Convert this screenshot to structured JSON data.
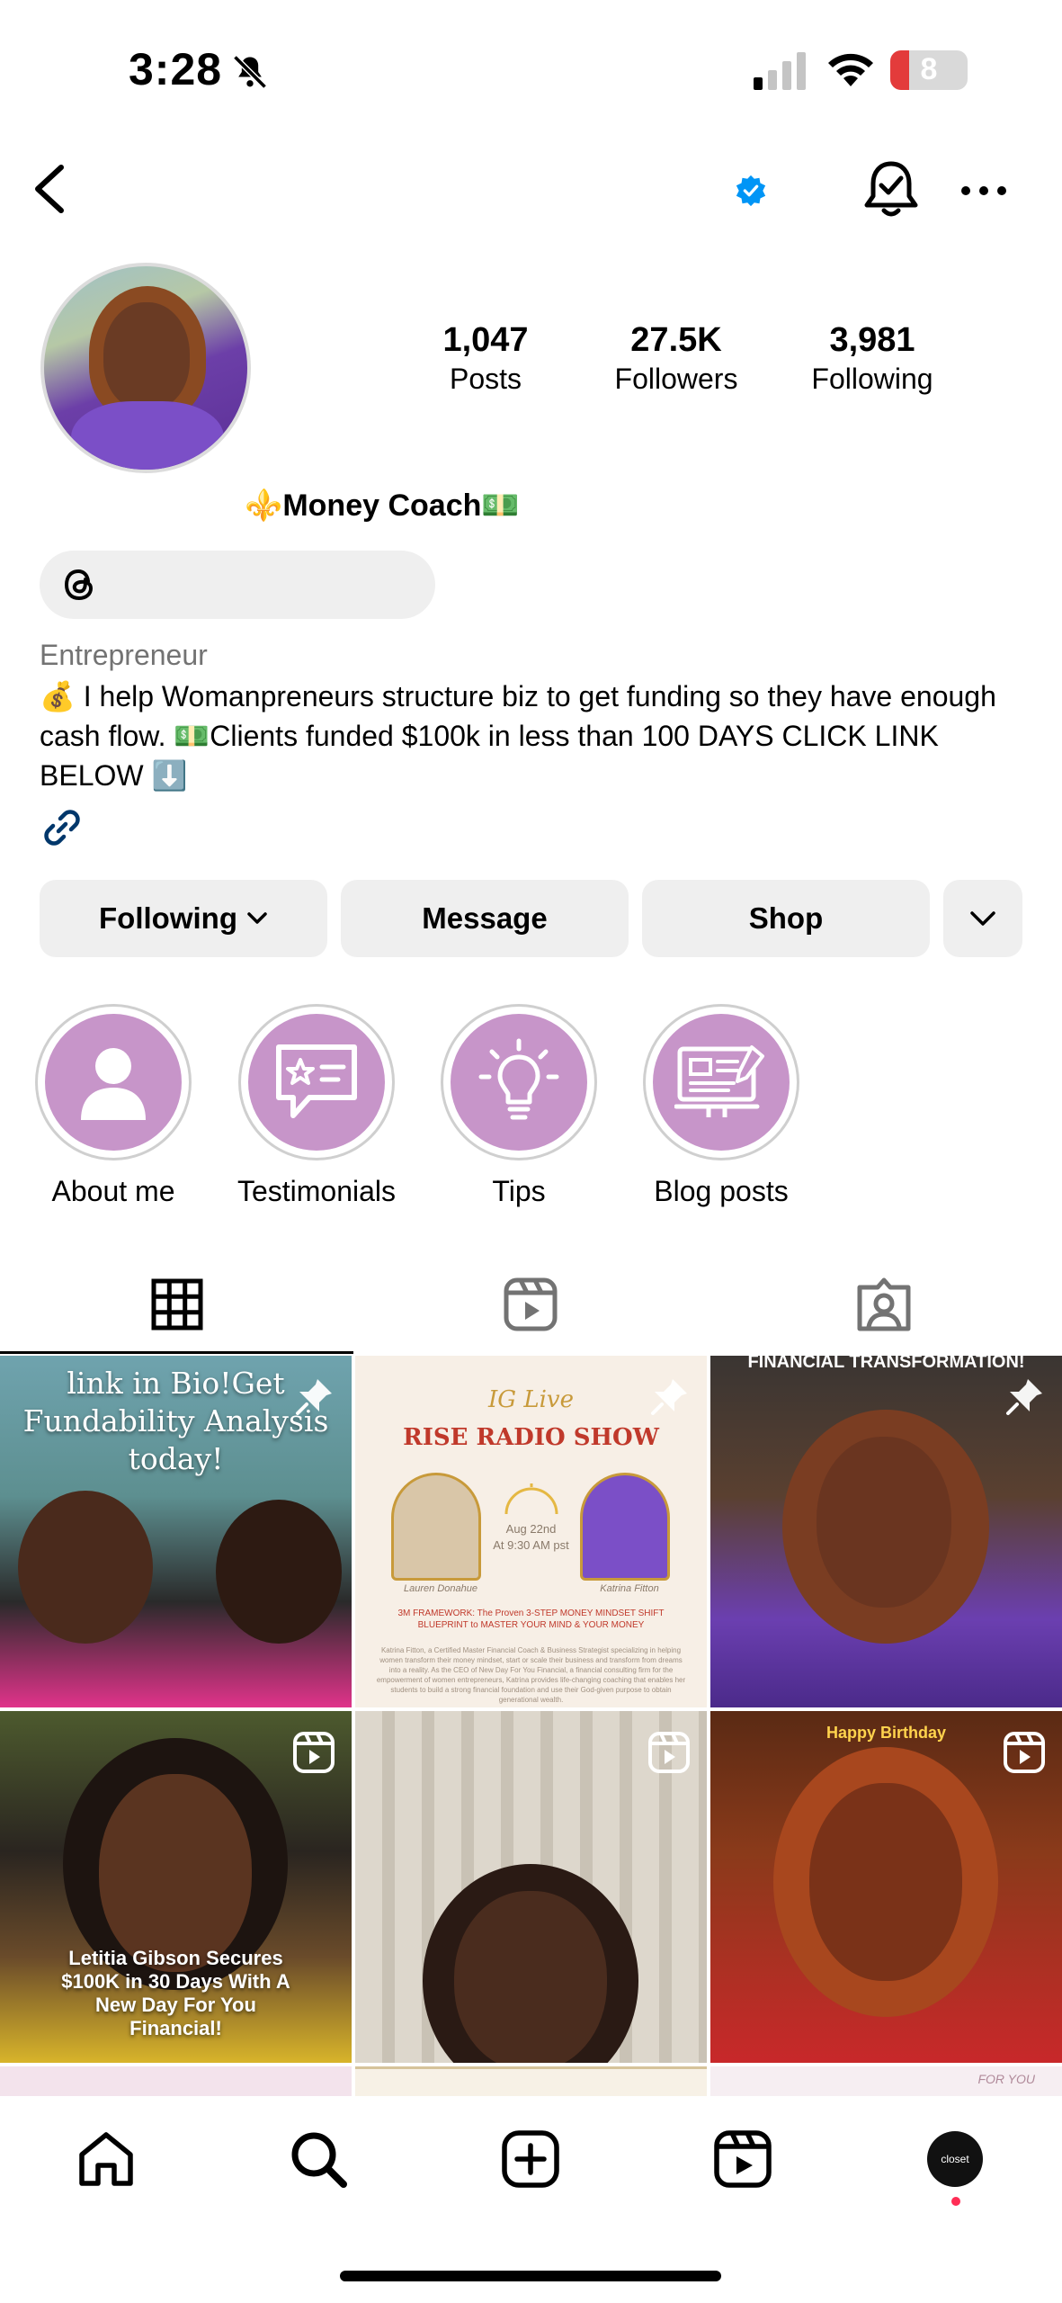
{
  "status_bar": {
    "time": "3:28",
    "battery": "8",
    "battery_fraction": 0.08
  },
  "profile": {
    "display_name": "⚜️Money Coach💵",
    "stats": [
      {
        "value": "1,047",
        "label": "Posts"
      },
      {
        "value": "27.5K",
        "label": "Followers"
      },
      {
        "value": "3,981",
        "label": "Following"
      }
    ],
    "category": "Entrepreneur",
    "bio": "💰 I help Womanpreneurs structure biz to get funding so they have enough cash flow. 💵Clients funded $100k in less than 100 DAYS CLICK LINK BELOW ⬇️"
  },
  "actions": {
    "following": "Following",
    "message": "Message",
    "shop": "Shop"
  },
  "highlights": [
    {
      "label": "About me",
      "icon": "person-icon"
    },
    {
      "label": "Testimonials",
      "icon": "speech-star-icon"
    },
    {
      "label": "Tips",
      "icon": "lightbulb-icon"
    },
    {
      "label": "Blog posts",
      "icon": "monitor-doc-icon"
    }
  ],
  "tabs": [
    "grid-icon",
    "reels-icon",
    "tagged-icon"
  ],
  "posts": {
    "p1_text": "link in Bio!Get Fundability Analysis today!",
    "p2_title": "IG Live",
    "p2_subtitle": "RISE RADIO SHOW",
    "p2_date": "Aug 22nd",
    "p2_time": "At 9:30 AM pst",
    "p2_name_left": "Lauren Donahue",
    "p2_name_right": "Katrina Fitton",
    "p2_blurb_title": "3M FRAMEWORK: The Proven 3-STEP MONEY MINDSET SHIFT BLUEPRINT to MASTER YOUR MIND & YOUR MONEY",
    "p2_blurb": "Katrina Fitton, a Certified Master Financial Coach & Business Strategist specializing in helping women transform their money mindset, start or scale their business and transform from dreams into a reality. As the CEO of New Day For You Financial, a financial consulting firm for the empowerment of women entrepreneurs, Katrina provides life-changing coaching that enables her students to build a strong financial foundation and use their God-given purpose to obtain generational wealth.",
    "p3_text": "FINANCIAL TRANSFORMATION!",
    "p4_text": "Letitia Gibson Secures $100K in 30 Days With A New Day For You Financial!",
    "p6_text": "Happy Birthday",
    "p9_text": "FOR YOU"
  },
  "nav": {
    "avatar_text": "closet"
  },
  "colors": {
    "accent_blue": "#0095f6",
    "highlight_purple": "#c795c9",
    "notification_red": "#ff2d55"
  }
}
